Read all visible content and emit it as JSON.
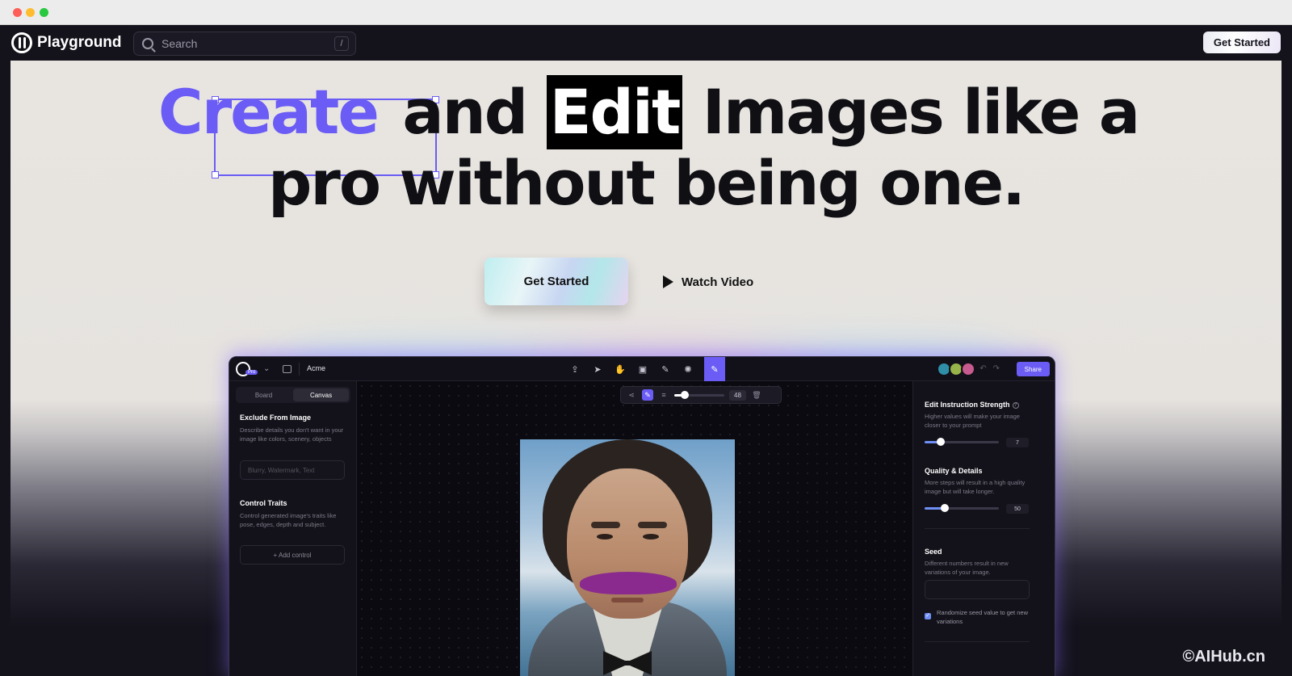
{
  "nav": {
    "brand": "Playground",
    "search_placeholder": "Search",
    "search_shortcut": "/",
    "cta": "Get Started"
  },
  "hero": {
    "headline_create": "Create",
    "headline_and": " and ",
    "headline_edit": "Edit",
    "headline_rest": " Images like a",
    "headline_line2": "pro without being one.",
    "primary_cta": "Get Started",
    "secondary_cta": "Watch Video"
  },
  "mock": {
    "project": "Acme",
    "logo_badge": "Pro",
    "share": "Share",
    "tabs": [
      "Board",
      "Canvas"
    ],
    "active_tab": "Canvas",
    "brush_size": "48",
    "left": {
      "exclude_title": "Exclude From Image",
      "exclude_desc": "Describe details you don't want in your image like colors, scenery, objects",
      "exclude_placeholder": "Blurry, Watermark, Text",
      "control_title": "Control Traits",
      "control_desc": "Control generated image's traits like pose, edges, depth and subject.",
      "add_control": "+ Add control"
    },
    "right": {
      "strength_title": "Edit Instruction Strength",
      "strength_desc": "Higher values will make your image closer to your prompt",
      "strength_value": "7",
      "strength_level": 0.22,
      "quality_title": "Quality & Details",
      "quality_desc": "More steps will result in a high quality image but will take longer.",
      "quality_value": "50",
      "quality_level": 0.27,
      "seed_title": "Seed",
      "seed_desc": "Different numbers result in new variations of your image.",
      "randomize_label": "Randomize seed value to get new variations",
      "randomize_checked": true
    }
  },
  "watermark": "©AIHub.cn",
  "colors": {
    "accent": "#6a5cf5",
    "nav_bg": "#14131c"
  }
}
